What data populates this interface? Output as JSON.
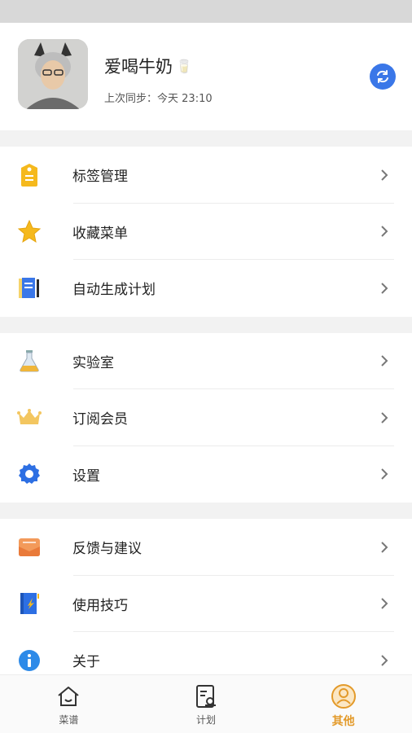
{
  "profile": {
    "name": "爱喝牛奶",
    "name_emoji": "🥛",
    "sync_label": "上次同步：",
    "sync_time": "今天 23:10"
  },
  "groups": [
    [
      {
        "label": "标签管理",
        "icon": "tag-icon"
      },
      {
        "label": "收藏菜单",
        "icon": "star-icon"
      },
      {
        "label": "自动生成计划",
        "icon": "notebook-icon"
      }
    ],
    [
      {
        "label": "实验室",
        "icon": "flask-icon"
      },
      {
        "label": "订阅会员",
        "icon": "crown-icon"
      },
      {
        "label": "设置",
        "icon": "gear-icon"
      }
    ],
    [
      {
        "label": "反馈与建议",
        "icon": "mail-icon"
      },
      {
        "label": "使用技巧",
        "icon": "book-icon"
      },
      {
        "label": "关于",
        "icon": "info-icon"
      }
    ]
  ],
  "tabs": [
    {
      "label": "菜谱",
      "icon": "home-icon",
      "active": false
    },
    {
      "label": "计划",
      "icon": "plan-icon",
      "active": false
    },
    {
      "label": "其他",
      "icon": "other-icon",
      "active": true
    }
  ],
  "colors": {
    "accent": "#e39a2a",
    "sync": "#3a77e8"
  }
}
